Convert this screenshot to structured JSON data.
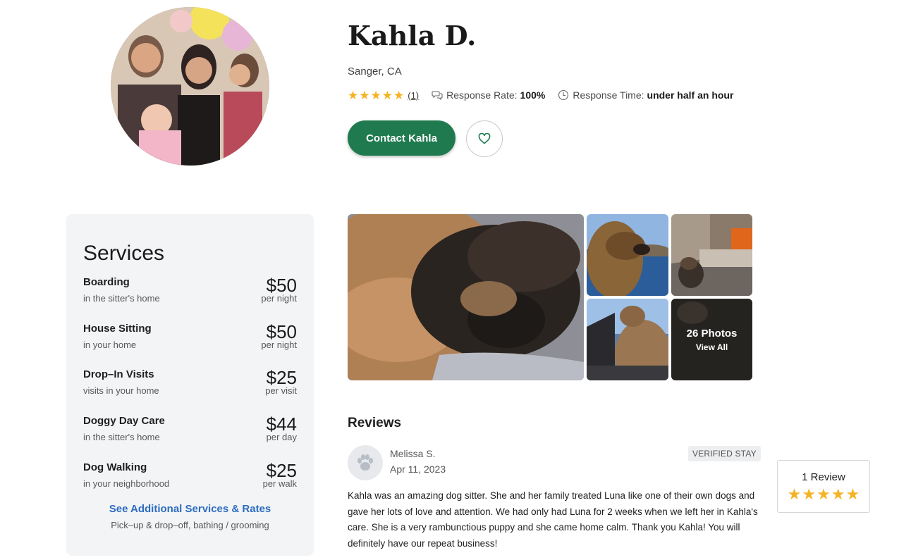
{
  "profile": {
    "name": "Kahla D.",
    "location": "Sanger, CA",
    "rating_stars": 5,
    "review_count_link": "(1)",
    "response_rate_label": "Response Rate:",
    "response_rate_value": "100%",
    "response_time_label": "Response Time:",
    "response_time_value": "under half an hour",
    "contact_label": "Contact Kahla"
  },
  "services": {
    "title": "Services",
    "items": [
      {
        "name": "Boarding",
        "sub": "in the sitter's home",
        "price": "$50",
        "unit": "per night"
      },
      {
        "name": "House Sitting",
        "sub": "in your home",
        "price": "$50",
        "unit": "per night"
      },
      {
        "name": "Drop–In Visits",
        "sub": "visits in your home",
        "price": "$25",
        "unit": "per visit"
      },
      {
        "name": "Doggy Day Care",
        "sub": "in the sitter's home",
        "price": "$44",
        "unit": "per day"
      },
      {
        "name": "Dog Walking",
        "sub": "in your neighborhood",
        "price": "$25",
        "unit": "per walk"
      }
    ],
    "see_more": "See Additional Services & Rates",
    "see_more_sub": "Pick–up & drop–off, bathing / grooming"
  },
  "gallery": {
    "photos_count": "26 Photos",
    "view_all": "View All"
  },
  "reviews": {
    "title": "Reviews",
    "items": [
      {
        "reviewer": "Melissa S.",
        "date": "Apr 11, 2023",
        "badge": "VERIFIED STAY",
        "text": "Kahla was an amazing dog sitter. She and her family treated Luna like one of their own dogs and gave her lots of love and attention. We had only had Luna for 2 weeks when we left her in Kahla's care. She is a very rambunctious puppy and she came home calm. Thank you Kahla! You will definitely have our repeat business!"
      }
    ],
    "summary_count": "1 Review",
    "summary_stars": 5
  },
  "colors": {
    "star": "#f5b324",
    "primary_button": "#1f7a4f",
    "link": "#2d6cc0",
    "panel_bg": "#f3f4f6"
  }
}
